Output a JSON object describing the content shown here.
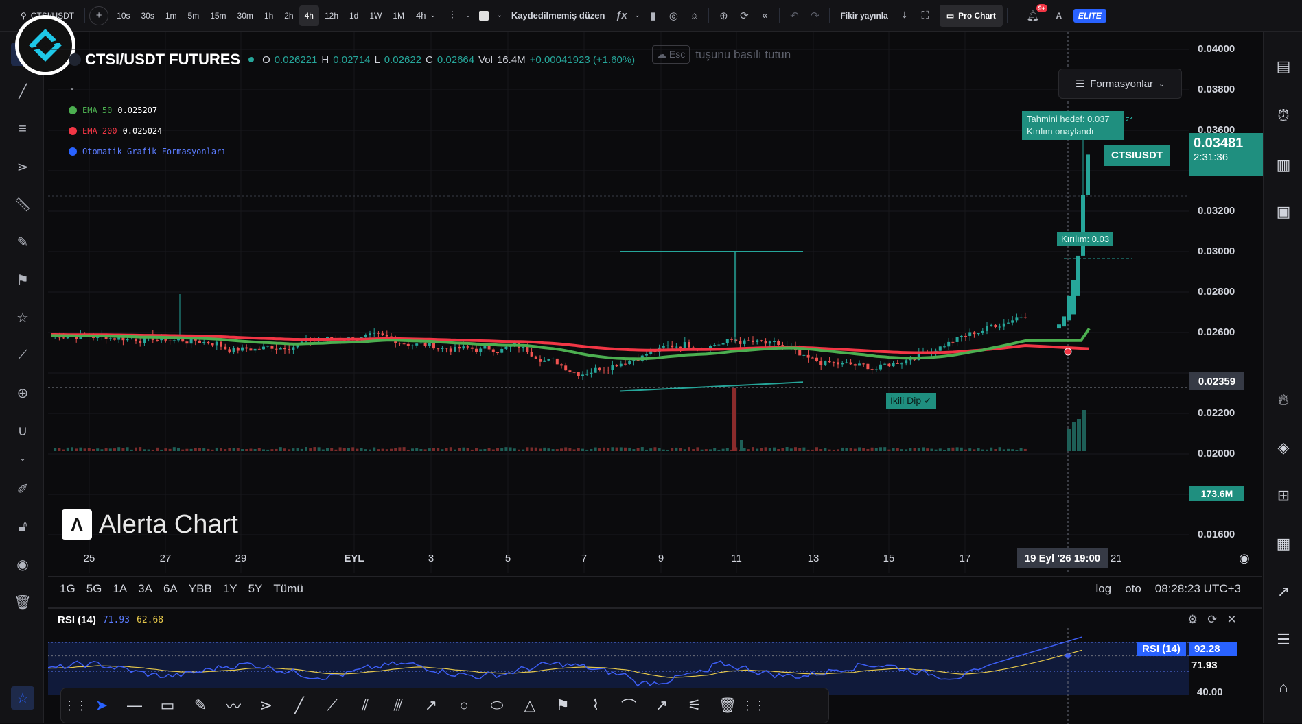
{
  "topbar": {
    "symbol_search": "CTSI/USDT",
    "intervals": [
      "10s",
      "30s",
      "1m",
      "5m",
      "15m",
      "30m",
      "1h",
      "2h",
      "4h",
      "12h",
      "1d",
      "1W",
      "1M"
    ],
    "active_interval": "4h",
    "interval_dropdown": "4h",
    "layout_label": "Kaydedilmemiş düzen",
    "publish_label": "Fikir yayınla",
    "pro_chart_label": "Pro Chart",
    "notif_badge": "9+",
    "account_initial": "A",
    "elite_label": "ELITE"
  },
  "legend": {
    "title": "CTSI/USDT FUTURES",
    "o_label": "O",
    "o_value": "0.026221",
    "h_label": "H",
    "h_value": "0.02714",
    "l_label": "L",
    "l_value": "0.02622",
    "c_label": "C",
    "c_value": "0.02664",
    "vol_label": "Vol",
    "vol_value": "16.4M",
    "change": "+0.00041923 (+1.60%)",
    "hint_text": "tuşunu basılı tutun",
    "hint_key": "Esc",
    "indicators": [
      {
        "name": "EMA 50",
        "value": "0.025207",
        "color": "#4caf50"
      },
      {
        "name": "EMA 200",
        "value": "0.025024",
        "color": "#f23645"
      },
      {
        "name": "Otomatik Grafik Formasyonları",
        "value": "",
        "color": "#2962ff"
      }
    ]
  },
  "patterns_button": "Formasyonlar",
  "annotations": {
    "target_line1": "Tahmini hedef: 0.037",
    "target_line2": "Kırılım onaylandı",
    "breakout": "Kırılım: 0.03",
    "double_bottom": "İkili Dip ✓"
  },
  "price_scale": {
    "ticks": [
      "0.04000",
      "0.03800",
      "0.03600",
      "0.03200",
      "0.03000",
      "0.02800",
      "0.02600",
      "0.02200",
      "0.02000",
      "0.01600"
    ],
    "symbol_tag": "CTSIUSDT",
    "last_price": "0.03481",
    "countdown": "2:31:36",
    "crosshair_price": "0.02359",
    "volume_tag": "173.6M"
  },
  "time_scale": {
    "ticks": [
      "25",
      "27",
      "29",
      "EYL",
      "3",
      "5",
      "7",
      "9",
      "11",
      "13",
      "15",
      "17"
    ],
    "crosshair_time": "19 Eyl '26 19:00",
    "partial": "21"
  },
  "watermark": "Alerta Chart",
  "ranges": [
    "1G",
    "5G",
    "1A",
    "3A",
    "6A",
    "YBB",
    "1Y",
    "5Y",
    "Tümü"
  ],
  "bottom_right": {
    "log": "log",
    "auto": "oto",
    "time": "08:28:23 UTC+3"
  },
  "rsi": {
    "title": "RSI (14)",
    "value": "71.93",
    "ma_value": "62.68",
    "tag_name": "RSI (14)",
    "tag_value": "92.28",
    "level_value": "71.93",
    "low_level": "40.00"
  },
  "colors": {
    "up": "#26a69a",
    "down": "#ef5350",
    "ema50": "#4caf50",
    "ema200": "#f23645",
    "accent": "#2962ff",
    "teal_box": "#1f8f7f"
  }
}
